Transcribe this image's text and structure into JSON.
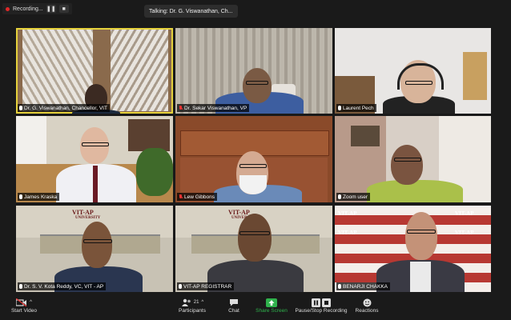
{
  "recording": {
    "label": "Recording..."
  },
  "talking": {
    "text": "Talking: Dr. G. Viswanathan, Ch..."
  },
  "tiles": [
    {
      "name": "Dr. G. Viswanathan, Chancellor, VIT",
      "muted": false
    },
    {
      "name": "Dr. Sekar Viswanathan, VP",
      "muted": true
    },
    {
      "name": "Laurent Pech",
      "muted": false
    },
    {
      "name": "James Kraska",
      "muted": false
    },
    {
      "name": "Lew Gibbons",
      "muted": true
    },
    {
      "name": "Zoom user",
      "muted": false
    },
    {
      "name": "Dr. S. V. Kota Reddy, VC, VIT - AP",
      "muted": false
    },
    {
      "name": "VIT-AP REGISTRAR",
      "muted": false
    },
    {
      "name": "BENARJI CHAKKA",
      "muted": false
    }
  ],
  "backgrounds": {
    "vit_logo": "VIT-AP",
    "vit_sub": "UNIVERSITY",
    "vit_wall": "VIT-AP",
    "vit_wall_sub": "UNIVERSITY"
  },
  "toolbar": {
    "start_video": "Start Video",
    "participants": "Participants",
    "participants_count": "21",
    "chat": "Chat",
    "share_screen": "Share Screen",
    "record": "Pause/Stop Recording",
    "reactions": "Reactions"
  },
  "colors": {
    "accent_green": "#2fb24c",
    "active_border": "#e6d23c",
    "mute_red": "#e33333"
  }
}
